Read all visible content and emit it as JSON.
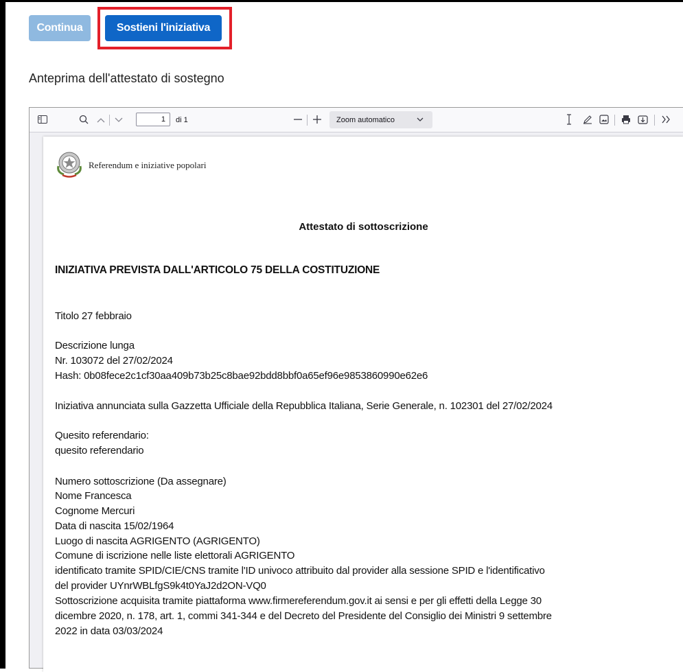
{
  "actions": {
    "continue_label": "Continua",
    "support_label": "Sostieni l'iniziativa"
  },
  "preview": {
    "title": "Anteprima dell'attestato di sostegno"
  },
  "viewer": {
    "toolbar": {
      "page_number": "1",
      "page_total": "di 1",
      "zoom_value": "Zoom automatico"
    }
  },
  "document": {
    "organization": "Referendum e iniziative popolari",
    "title": "Attestato di sottoscrizione",
    "heading": "INIZIATIVA PREVISTA DALL'ARTICOLO 75 DELLA COSTITUZIONE",
    "lines": {
      "titolo": "Titolo 27 febbraio",
      "descrizione": "Descrizione lunga",
      "numero": "Nr. 103072 del 27/02/2024",
      "hash": "Hash: 0b08fece2c1cf30aa409b73b25c8bae92bdd8bbf0a65ef96e9853860990e62e6",
      "gazzetta": "Iniziativa annunciata sulla Gazzetta Ufficiale della Repubblica Italiana, Serie Generale, n. 102301 del 27/02/2024",
      "quesito_label": "Quesito referendario:",
      "quesito_value": "quesito referendario",
      "numero_sottoscrizione": "Numero sottoscrizione (Da assegnare)",
      "nome": "Nome Francesca",
      "cognome": "Cognome Mercuri",
      "data_nascita": "Data di nascita 15/02/1964",
      "luogo_nascita": "Luogo di nascita AGRIGENTO (AGRIGENTO)",
      "comune": "Comune di iscrizione nelle liste elettorali AGRIGENTO",
      "identificato_1": "identificato tramite SPID/CIE/CNS tramite l'ID univoco attribuito dal provider alla sessione SPID e l'identificativo",
      "identificato_2": "del provider UYnrWBLfgS9k4t0YaJ2d2ON-VQ0",
      "sottoscrizione_1": "Sottoscrizione acquisita tramite piattaforma www.firmereferendum.gov.it ai sensi e per gli effetti della Legge 30",
      "sottoscrizione_2": "dicembre 2020, n. 178, art. 1, commi 341-344 e del Decreto del Presidente del Consiglio dei Ministri 9 settembre",
      "sottoscrizione_3": "2022 in data 03/03/2024"
    }
  }
}
